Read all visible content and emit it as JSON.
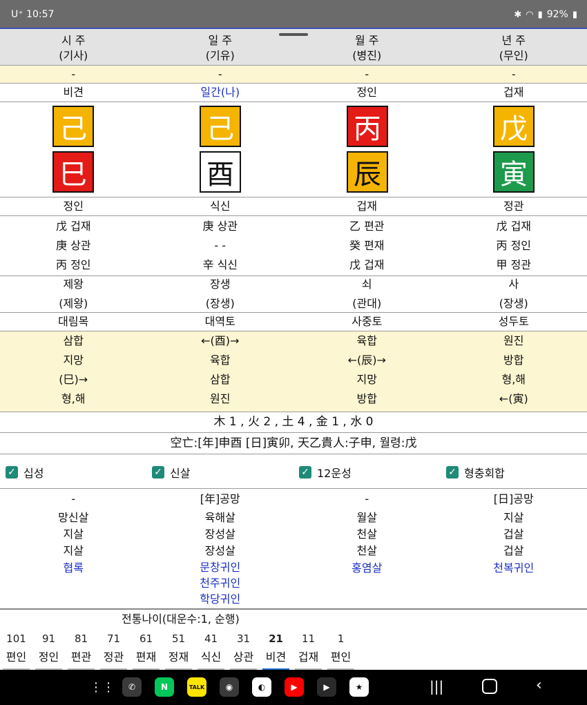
{
  "status": {
    "carrier": "U⁺",
    "time": "10:57",
    "battery": "92%"
  },
  "header": [
    {
      "title": "시 주",
      "sub": "(기사)"
    },
    {
      "title": "일 주",
      "sub": "(기유)"
    },
    {
      "title": "월 주",
      "sub": "(병진)"
    },
    {
      "title": "년 주",
      "sub": "(무인)"
    }
  ],
  "dash_row": [
    "-",
    "-",
    "-",
    "-"
  ],
  "sipsung_top": [
    "비견",
    "일간(나)",
    "정인",
    "겁재"
  ],
  "stems": [
    {
      "char": "己",
      "bg": "#f5b400",
      "fg": "#ffffff"
    },
    {
      "char": "己",
      "bg": "#f5b400",
      "fg": "#ffffff"
    },
    {
      "char": "丙",
      "bg": "#e41b17",
      "fg": "#ffffff"
    },
    {
      "char": "戊",
      "bg": "#f5b400",
      "fg": "#ffffff"
    }
  ],
  "branches": [
    {
      "char": "巳",
      "bg": "#e41b17",
      "fg": "#ffffff"
    },
    {
      "char": "酉",
      "bg": "#ffffff",
      "fg": "#111111"
    },
    {
      "char": "辰",
      "bg": "#f5b400",
      "fg": "#111111"
    },
    {
      "char": "寅",
      "bg": "#1e9a4c",
      "fg": "#ffffff"
    }
  ],
  "sipsung_bottom": [
    "정인",
    "식신",
    "겁재",
    "정관"
  ],
  "jijanggan": [
    [
      "戊 겁재",
      "庚 상관",
      "丙 정인"
    ],
    [
      "庚 상관",
      "- -",
      "辛 식신"
    ],
    [
      "乙 편관",
      "癸 편재",
      "戊 겁재"
    ],
    [
      "戊 겁재",
      "丙 정인",
      "甲 정관"
    ]
  ],
  "unsung": [
    [
      "제왕",
      "(제왕)"
    ],
    [
      "장생",
      "(장생)"
    ],
    [
      "쇠",
      "(관대)"
    ],
    [
      "사",
      "(장생)"
    ]
  ],
  "napeum": [
    "대림목",
    "대역토",
    "사중토",
    "성두토"
  ],
  "relations": [
    [
      "삼합",
      "지망",
      "(巳)→",
      "형,해"
    ],
    [
      "←(酉)→",
      "육합",
      "삼합",
      "원진"
    ],
    [
      "육합",
      "←(辰)→",
      "지망",
      "방합"
    ],
    [
      "원진",
      "방합",
      "형,해",
      "←(寅)"
    ]
  ],
  "elements": "木 1 , 火 2 , 土 4 , 金 1 , 水 0",
  "gongmang": "空亡:[年]申酉 [日]寅卯, 天乙貴人:子申, 월령:戊",
  "checkboxes": [
    "십성",
    "신살",
    "12운성",
    "형충회합"
  ],
  "sinsal": [
    {
      "top": "-",
      "items": [
        "망신살",
        "지살",
        "지살"
      ],
      "blue": [
        "협록"
      ]
    },
    {
      "top": "[年]공망",
      "items": [
        "육해살",
        "장성살",
        "장성살"
      ],
      "blue": [
        "문창귀인",
        "천주귀인",
        "학당귀인"
      ]
    },
    {
      "top": "-",
      "items": [
        "월살",
        "천살",
        "천살"
      ],
      "blue": [
        "홍염살"
      ]
    },
    {
      "top": "[日]공망",
      "items": [
        "지살",
        "겁살",
        "겁살"
      ],
      "blue": [
        "천복귀인"
      ]
    }
  ],
  "daeun_title": "전통나이(대운수:1, 순행)",
  "daeun": [
    {
      "age": "101",
      "label": "편인"
    },
    {
      "age": "91",
      "label": "정인"
    },
    {
      "age": "81",
      "label": "편관"
    },
    {
      "age": "71",
      "label": "정관"
    },
    {
      "age": "61",
      "label": "편재"
    },
    {
      "age": "51",
      "label": "정재"
    },
    {
      "age": "41",
      "label": "식신"
    },
    {
      "age": "31",
      "label": "상관"
    },
    {
      "age": "21",
      "label": "비견",
      "selected": true
    },
    {
      "age": "11",
      "label": "겁재"
    },
    {
      "age": "1",
      "label": "편인"
    }
  ],
  "nav_apps": [
    {
      "name": "phone-app-icon",
      "glyph": "✆",
      "bg": "#3a3a3a"
    },
    {
      "name": "naver-app-icon",
      "glyph": "N",
      "bg": "#03c75a"
    },
    {
      "name": "kakaotalk-app-icon",
      "glyph": "TALK",
      "bg": "#fee500"
    },
    {
      "name": "camera-app-icon",
      "glyph": "◉",
      "bg": "#3a3a3a"
    },
    {
      "name": "green-app-icon",
      "glyph": "◐",
      "bg": "#ffffff"
    },
    {
      "name": "youtube-app-icon",
      "glyph": "▶",
      "bg": "#ff0000"
    },
    {
      "name": "play-store-app-icon",
      "glyph": "▶",
      "bg": "#2a2a2a"
    },
    {
      "name": "record-app-icon",
      "glyph": "★",
      "bg": "#ffffff"
    }
  ]
}
